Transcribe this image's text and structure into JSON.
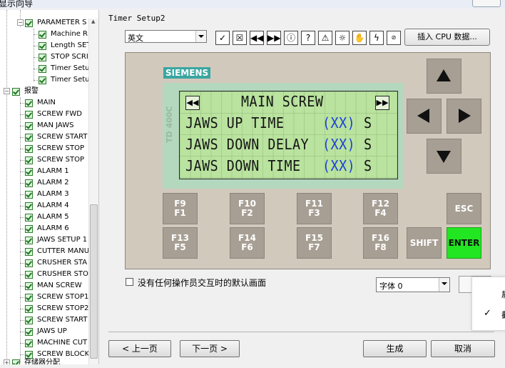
{
  "window": {
    "title": "显示向导"
  },
  "tree": {
    "parameter_items": [
      "PARAMETER S",
      "Machine R",
      "Length SET",
      "STOP SCRI",
      "Timer Setu",
      "Timer Setu"
    ],
    "alarm_group": "报警",
    "alarm_items": [
      "MAIN",
      "SCREW FWD",
      "MAN JAWS",
      "SCREW START",
      "SCREW STOP",
      "SCREW STOP",
      "ALARM 1",
      "ALARM 2",
      "ALARM 3",
      "ALARM 4",
      "ALARM 5",
      "ALARM 6",
      "JAWS SETUP 1",
      "CUTTER MANU",
      "CRUSHER STA",
      "CRUSHER STO",
      "MAN SCREW",
      "SCREW STOP1",
      "SCREW STOP2",
      "SCREW START",
      "JAWS UP",
      "MACHINE CUT",
      "SCREW BLOCK"
    ],
    "bottom_item": "存储器分配"
  },
  "panel": {
    "title": "Timer Setup2",
    "language": "英文",
    "toolbar_icons": [
      "check-icon",
      "cross-box-icon",
      "rewind-icon",
      "fast-forward-icon",
      "info-icon",
      "help-icon",
      "warning-icon",
      "bulb-icon",
      "hand-icon",
      "lightning-icon",
      "stop-icon"
    ],
    "insert_button": "插入 CPU 数据...",
    "brand": "SIEMENS",
    "device_model": "TD 400C",
    "lcd": {
      "line1": "MAIN SCREW",
      "line2_text": "JAWS UP TIME",
      "line3_text": "JAWS DOWN DELAY",
      "line4_text": "JAWS DOWN TIME",
      "field": "(XX)",
      "unit": "S"
    },
    "fkeys": [
      {
        "top": "F9",
        "bottom": "F1"
      },
      {
        "top": "F10",
        "bottom": "F2"
      },
      {
        "top": "F11",
        "bottom": "F3"
      },
      {
        "top": "F12",
        "bottom": "F4"
      },
      {
        "top": "F13",
        "bottom": "F5"
      },
      {
        "top": "F14",
        "bottom": "F6"
      },
      {
        "top": "F15",
        "bottom": "F7"
      },
      {
        "top": "F16",
        "bottom": "F8"
      }
    ],
    "esc": "ESC",
    "shift": "SHIFT",
    "enter": "ENTER",
    "default_screen_label": "没有任何操作员交互时的默认画面",
    "font_select": "字体 0",
    "context_menu": [
      "肩",
      "截"
    ]
  },
  "colors": {
    "enter": "#22e622",
    "lcd": "#b9e39f",
    "brand": "#3aa6a0",
    "lcd_field": "#1d3fd6"
  },
  "buttons": {
    "prev": "< 上一页",
    "next": "下一页 >",
    "generate": "生成",
    "cancel": "取消"
  }
}
